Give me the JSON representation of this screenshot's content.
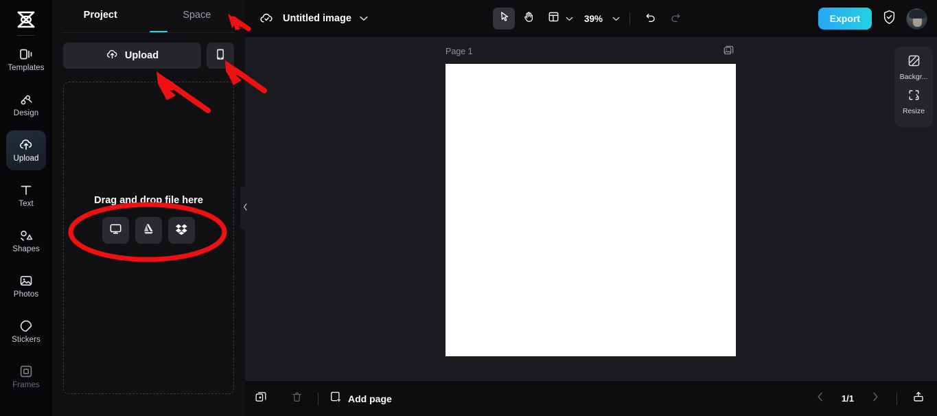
{
  "app": {
    "logo_icon": "capcut-logo-icon",
    "background_color": "#0d0d0f",
    "accent_color": "#27d7e7"
  },
  "rail": {
    "items": [
      {
        "label": "Templates",
        "icon": "templates-icon",
        "active": false,
        "dim": false
      },
      {
        "label": "Design",
        "icon": "design-icon",
        "active": false,
        "dim": false
      },
      {
        "label": "Upload",
        "icon": "upload-cloud-icon",
        "active": true,
        "dim": false
      },
      {
        "label": "Text",
        "icon": "text-icon",
        "active": false,
        "dim": false
      },
      {
        "label": "Shapes",
        "icon": "shapes-icon",
        "active": false,
        "dim": false
      },
      {
        "label": "Photos",
        "icon": "photos-icon",
        "active": false,
        "dim": false
      },
      {
        "label": "Stickers",
        "icon": "stickers-icon",
        "active": false,
        "dim": false
      },
      {
        "label": "Frames",
        "icon": "frames-icon",
        "active": false,
        "dim": true
      }
    ]
  },
  "panel": {
    "tabs": [
      {
        "label": "Project",
        "active": true
      },
      {
        "label": "Space",
        "active": false
      }
    ],
    "upload_button_label": "Upload",
    "upload_button_icon": "upload-cloud-icon",
    "phone_button_icon": "mobile-phone-icon",
    "dropzone": {
      "title": "Drag and drop file here",
      "sources": [
        {
          "name": "computer",
          "icon": "monitor-icon"
        },
        {
          "name": "google-drive",
          "icon": "google-drive-icon"
        },
        {
          "name": "dropbox",
          "icon": "dropbox-icon"
        }
      ]
    },
    "collapse_icon": "chevron-left-icon"
  },
  "topbar": {
    "cloud_icon": "cloud-sync-icon",
    "document_title": "Untitled image",
    "title_chevron_icon": "chevron-down-icon",
    "tools": [
      {
        "name": "select-tool",
        "icon": "cursor-arrow-icon",
        "active": true
      },
      {
        "name": "hand-tool",
        "icon": "hand-icon",
        "active": false
      },
      {
        "name": "layout-tool",
        "icon": "layout-frame-icon",
        "active": false
      }
    ],
    "layout_chevron_icon": "chevron-down-icon",
    "zoom_level": "39%",
    "zoom_chevron_icon": "chevron-down-icon",
    "undo_icon": "undo-icon",
    "redo_icon": "redo-icon",
    "export_label": "Export",
    "shield_icon": "shield-check-icon",
    "avatar_name": "user-avatar"
  },
  "stage": {
    "page_label": "Page 1",
    "page_action_icon": "duplicate-image-icon",
    "canvas_color": "#ffffff",
    "right_tools": [
      {
        "label": "Backgr...",
        "icon": "background-pattern-icon"
      },
      {
        "label": "Resize",
        "icon": "resize-icon"
      }
    ]
  },
  "bottombar": {
    "duplicate_icon": "duplicate-page-icon",
    "delete_icon": "trash-icon",
    "add_page_label": "Add page",
    "add_page_icon": "add-page-icon",
    "prev_icon": "chevron-left-icon",
    "page_indicator": "1/1",
    "next_icon": "chevron-right-icon",
    "present_icon": "present-icon"
  },
  "annotations": {
    "color": "#ee1111",
    "arrows": [
      {
        "name": "arrow-to-space-tab"
      },
      {
        "name": "arrow-to-upload-button"
      },
      {
        "name": "arrow-to-phone-button"
      }
    ],
    "ellipses": [
      {
        "name": "ellipse-around-upload-sources"
      }
    ]
  }
}
